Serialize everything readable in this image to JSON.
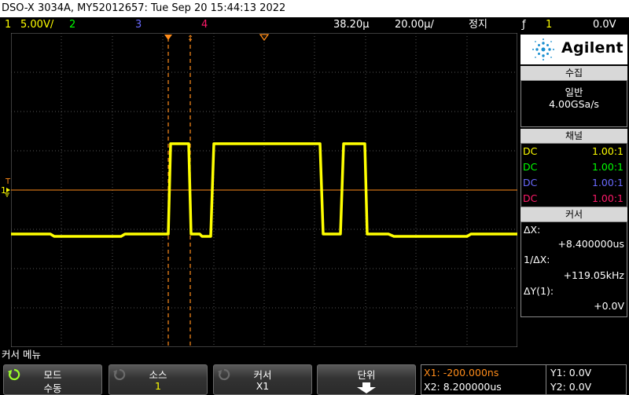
{
  "title": "DSO-X 3034A, MY52012657: Tue Sep 20 15:44:13 2022",
  "status": {
    "ch1_num": "1",
    "ch1_scale": "5.00V/",
    "ch2_num": "2",
    "ch3_num": "3",
    "ch4_num": "4",
    "time_pos": "38.20µ",
    "time_scale": "20.00µ/",
    "run_state": "정지",
    "trig_src": "1",
    "trig_level": "0.0V"
  },
  "markers": {
    "trigger_t": "T",
    "ch1_ground": "1"
  },
  "sidepanel": {
    "brand": "Agilent",
    "acq_header": "수집",
    "acq_mode": "일반",
    "acq_rate": "4.00GSa/s",
    "chan_header": "채널",
    "channels": [
      {
        "coupling": "DC",
        "probe": "1.00:1",
        "color": "#ffff00"
      },
      {
        "coupling": "DC",
        "probe": "1.00:1",
        "color": "#00ff00"
      },
      {
        "coupling": "DC",
        "probe": "1.00:1",
        "color": "#6a6aff"
      },
      {
        "coupling": "DC",
        "probe": "1.00:1",
        "color": "#ff1a6a"
      }
    ],
    "cursor_header": "커서",
    "dx_label": "ΔX:",
    "dx_value": "+8.400000us",
    "inv_dx_label": "1/ΔX:",
    "inv_dx_value": "+119.05kHz",
    "dy_label": "ΔY(1):",
    "dy_value": "+0.0V"
  },
  "menu_title": "커서 메뉴",
  "softkeys": {
    "mode_label": "모드",
    "mode_value": "수동",
    "source_label": "소스",
    "source_value": "1",
    "cursor_label": "커서",
    "cursor_value": "X1",
    "unit_label": "단위"
  },
  "cursor_readout": {
    "x1": "X1: -200.000ns",
    "x2": "X2: 8.200000us",
    "y1": "Y1: 0.0V",
    "y2": "Y2: 0.0V"
  },
  "colors": {
    "ch1": "#ffff00",
    "ch2": "#00ff00",
    "ch3": "#6a6aff",
    "ch4": "#ff1a6a",
    "cursor": "#ff8c1a",
    "grid": "#555555"
  }
}
